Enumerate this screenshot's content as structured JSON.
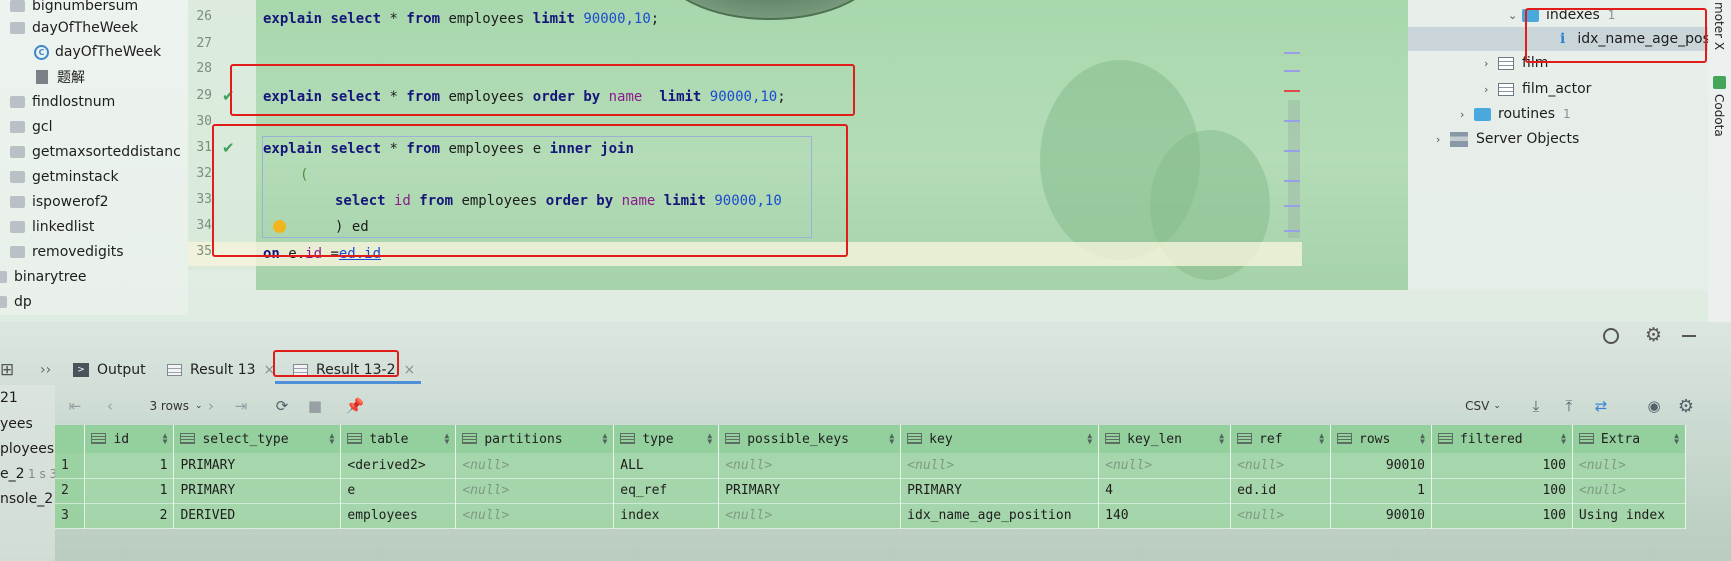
{
  "project_tree": [
    {
      "label": "bignumbersum",
      "icon": "folder-icon"
    },
    {
      "label": "dayOfTheWeek",
      "icon": "folder-icon"
    },
    {
      "label": "dayOfTheWeek",
      "icon": "class-icon"
    },
    {
      "label": "题解",
      "icon": "document-icon"
    },
    {
      "label": "findlostnum",
      "icon": "folder-icon"
    },
    {
      "label": "gcl",
      "icon": "folder-icon"
    },
    {
      "label": "getmaxsorteddistanc",
      "icon": "folder-icon"
    },
    {
      "label": "getminstack",
      "icon": "folder-icon"
    },
    {
      "label": "ispowerof2",
      "icon": "folder-icon"
    },
    {
      "label": "linkedlist",
      "icon": "folder-icon"
    },
    {
      "label": "removedigits",
      "icon": "folder-icon"
    },
    {
      "label": "binarytree",
      "icon": "folder-icon"
    },
    {
      "label": "dp",
      "icon": "folder-icon"
    }
  ],
  "editor": {
    "line_numbers": [
      "26",
      "27",
      "28",
      "29",
      "30",
      "31",
      "32",
      "33",
      "34",
      "35"
    ],
    "lines": {
      "l26": {
        "kw1": "explain",
        "kw2": "select",
        "star": " * ",
        "kw3": "from",
        "tbl": " employees ",
        "kw4": "limit",
        "num": " 90000,10",
        "end": ";"
      },
      "l29": {
        "kw1": "explain",
        "kw2": "select",
        "star": " * ",
        "kw3": "from",
        "tbl": " employees ",
        "kw4": "order by",
        "col": " name  ",
        "kw5": "limit",
        "num": " 90000,10",
        "end": ";"
      },
      "l31": {
        "kw1": "explain",
        "kw2": "select",
        "star": " * ",
        "kw3": "from",
        "tbl": " employees e ",
        "kw4": "inner join"
      },
      "l32": {
        "text": "("
      },
      "l33": {
        "kw1": "select",
        "col1": " id ",
        "kw2": "from",
        "tbl": " employees ",
        "kw3": "order by",
        "col2": " name ",
        "kw4": "limit",
        "num": " 90000,10"
      },
      "l34": {
        "text": ") ed"
      },
      "l35": {
        "kw1": "on",
        "pre": " e.",
        "col1": "id",
        "eq": " =",
        "link": "ed.id"
      }
    }
  },
  "db_tree": [
    {
      "label": "indexes",
      "count": "1",
      "icon": "folder-icon"
    },
    {
      "label": "idx_name_age_pos",
      "icon": "index-icon"
    },
    {
      "label": "film",
      "icon": "table-icon"
    },
    {
      "label": "film_actor",
      "icon": "table-icon"
    },
    {
      "label": "routines",
      "count": "1",
      "icon": "folder-icon"
    },
    {
      "label": "Server Objects",
      "icon": "server-icon"
    }
  ],
  "vertical_tools": [
    "moter X",
    "Codota"
  ],
  "bottom_tabs": {
    "output": "Output",
    "result13": "Result 13",
    "result13_2": "Result 13-2"
  },
  "toolbar": {
    "rows": "3 rows",
    "format": "CSV"
  },
  "left_console": [
    "21",
    "yees",
    "ployees",
    "e_2",
    "1 s 3",
    "nsole_2"
  ],
  "result_grid": {
    "columns": [
      "id",
      "select_type",
      "table",
      "partitions",
      "type",
      "possible_keys",
      "key",
      "key_len",
      "ref",
      "rows",
      "filtered",
      "Extra"
    ],
    "rows": [
      {
        "n": "1",
        "id": "1",
        "select_type": "PRIMARY",
        "table": "<derived2>",
        "partitions": "<null>",
        "type": "ALL",
        "possible_keys": "<null>",
        "key": "<null>",
        "key_len": "<null>",
        "ref": "<null>",
        "rows": "90010",
        "filtered": "100",
        "Extra": "<null>"
      },
      {
        "n": "2",
        "id": "1",
        "select_type": "PRIMARY",
        "table": "e",
        "partitions": "<null>",
        "type": "eq_ref",
        "possible_keys": "PRIMARY",
        "key": "PRIMARY",
        "key_len": "4",
        "ref": "ed.id",
        "rows": "1",
        "filtered": "100",
        "Extra": "<null>"
      },
      {
        "n": "3",
        "id": "2",
        "select_type": "DERIVED",
        "table": "employees",
        "partitions": "<null>",
        "type": "index",
        "possible_keys": "<null>",
        "key": "idx_name_age_position",
        "key_len": "140",
        "ref": "<null>",
        "rows": "90010",
        "filtered": "100",
        "Extra": "Using index"
      }
    ]
  },
  "colors": {
    "highlight_box": "#e21b1b",
    "keyword": "#15157a",
    "number": "#1a4bd0",
    "grid": "#9fd6a4"
  }
}
